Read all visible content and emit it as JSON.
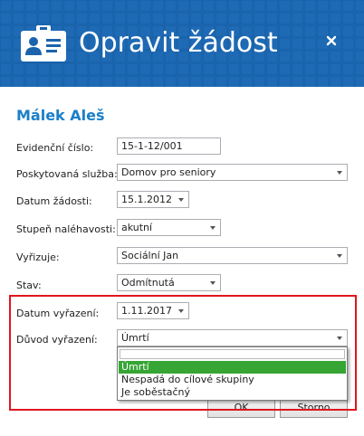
{
  "dialog": {
    "title": "Opravit žádost",
    "icon": "id-badge-icon",
    "close_icon": "close-icon",
    "accent": "#1a64ad"
  },
  "person": {
    "name": "Málek Aleš"
  },
  "form": {
    "evidencni_cislo": {
      "label": "Evidenční číslo:",
      "value": "15-1-12/001"
    },
    "poskytovana_sluzba": {
      "label": "Poskytovaná služba:",
      "value": "Domov pro seniory"
    },
    "datum_zadosti": {
      "label": "Datum žádosti:",
      "value": "15.1.2012"
    },
    "stupen_nalehavosti": {
      "label": "Stupeň naléhavosti:",
      "value": "akutní"
    },
    "vyrizuje": {
      "label": "Vyřizuje:",
      "value": "Sociální Jan"
    },
    "stav": {
      "label": "Stav:",
      "value": "Odmítnutá"
    },
    "datum_vyrazeni": {
      "label": "Datum vyřazení:",
      "value": "1.11.2017"
    },
    "duvod_vyrazeni": {
      "label": "Důvod vyřazení:",
      "value": "Úmrtí",
      "options": [
        "Úmrtí",
        "Nespadá do cílové skupiny",
        "Je soběstačný"
      ]
    }
  },
  "buttons": {
    "ok": "OK",
    "cancel": "Storno"
  },
  "colors": {
    "highlight_border": "#e0161d",
    "selected_option": "#36a534",
    "name_color": "#1a7fc8"
  }
}
